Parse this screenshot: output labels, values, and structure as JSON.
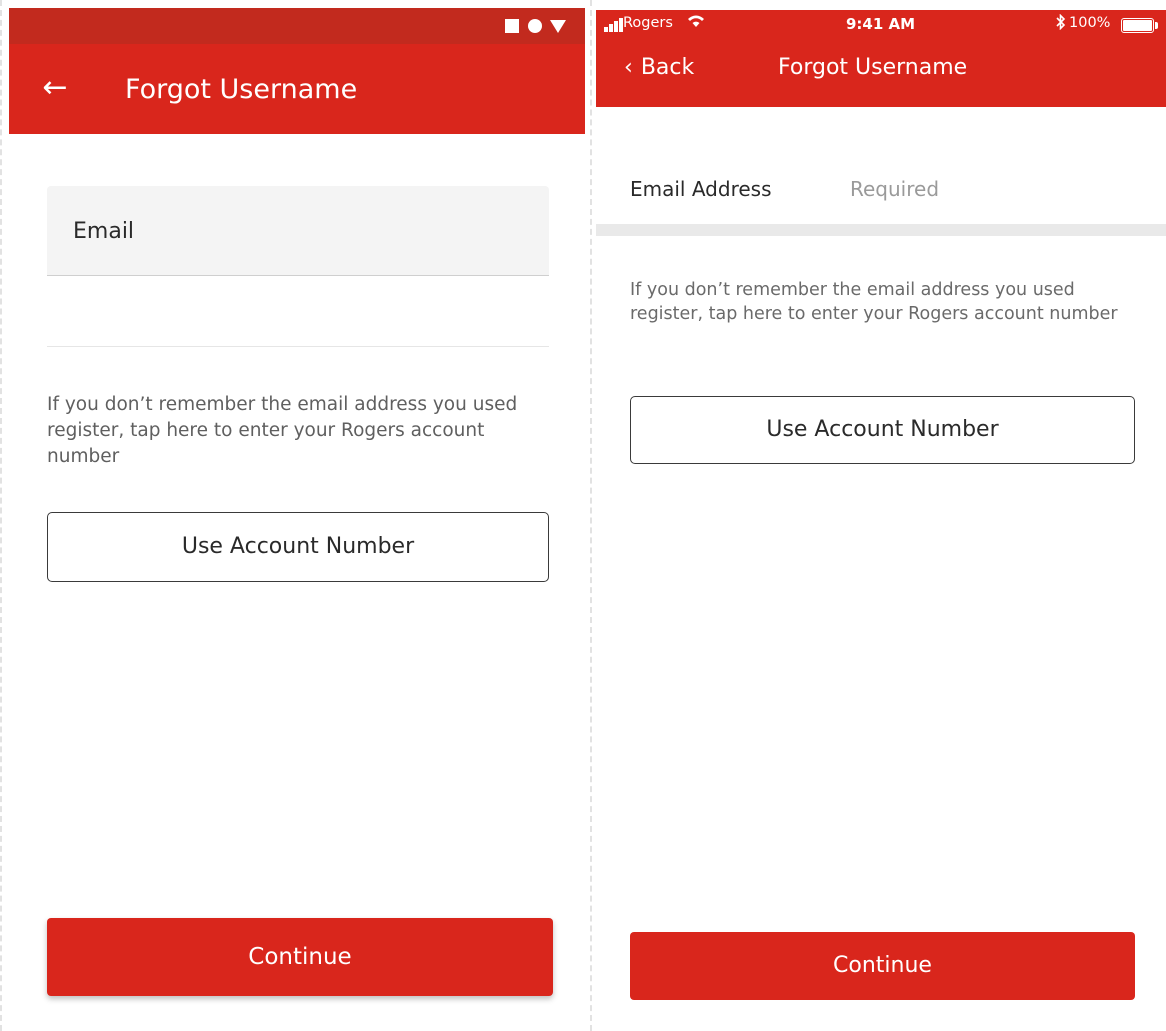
{
  "android": {
    "status_icons": [
      "square-icon",
      "circle-icon",
      "triangle-down-icon"
    ],
    "back_glyph": "←",
    "title": "Forgot Username",
    "email_label": "Email",
    "help_text": "If you don’t remember the email address you used register, tap here to enter your Rogers account number",
    "account_button": "Use Account Number",
    "continue_button": "Continue"
  },
  "ios": {
    "carrier": "Rogers",
    "time": "9:41 AM",
    "battery": "100%",
    "back_label": "Back",
    "title": "Forgot Username",
    "field_label": "Email Address",
    "field_placeholder": "Required",
    "help_text": "If you don’t remember the email address you used register, tap here to enter your Rogers account number",
    "account_button": "Use Account Number",
    "continue_button": "Continue"
  },
  "colors": {
    "brand_red": "#d9261c",
    "status_red": "#c22a1e"
  }
}
